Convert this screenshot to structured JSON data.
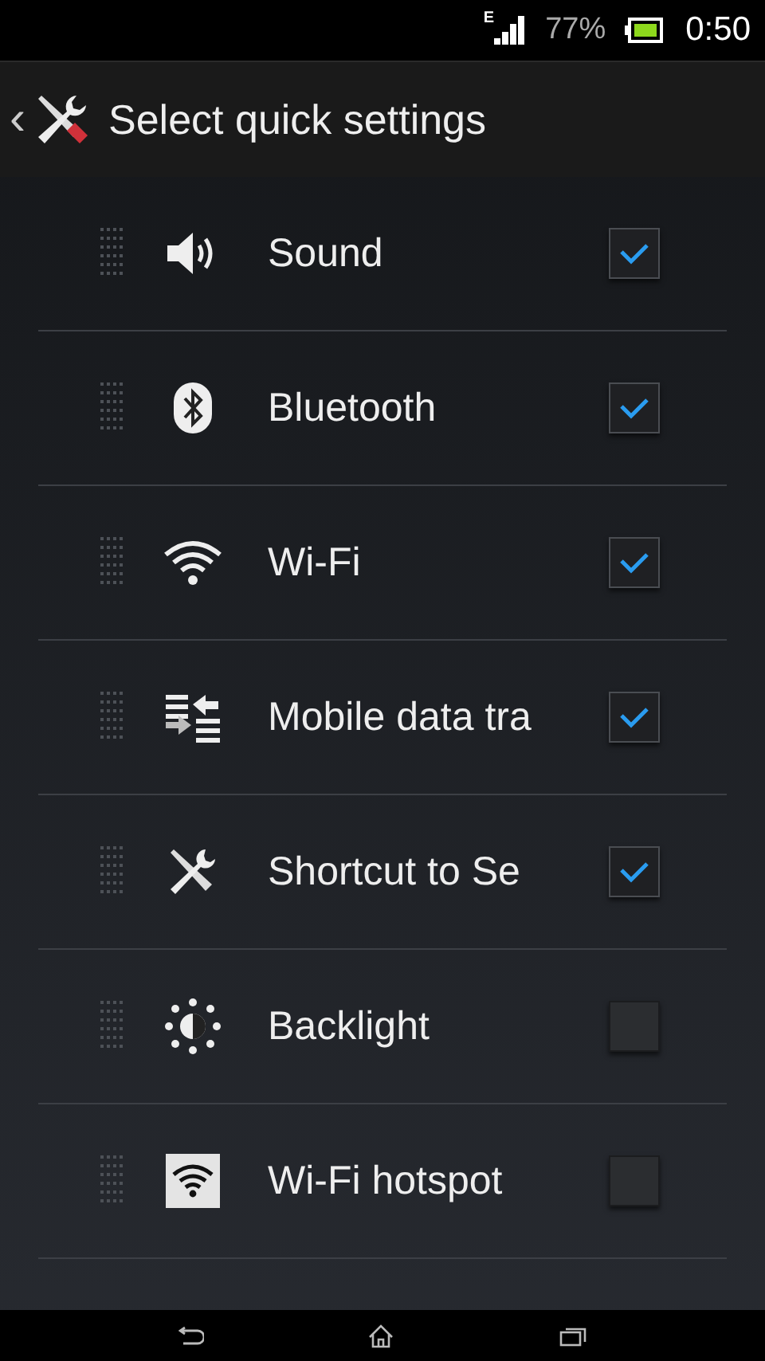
{
  "status_bar": {
    "network": "E",
    "battery": "77%",
    "time": "0:50"
  },
  "header": {
    "back": "‹",
    "title": "Select quick settings"
  },
  "items": [
    {
      "kind": "sound",
      "label": "Sound",
      "checked": true
    },
    {
      "kind": "bluetooth",
      "label": "Bluetooth",
      "checked": true
    },
    {
      "kind": "wifi",
      "label": "Wi-Fi",
      "checked": true
    },
    {
      "kind": "data",
      "label": "Mobile data tra",
      "checked": true
    },
    {
      "kind": "tools",
      "label": "Shortcut to Se",
      "checked": true
    },
    {
      "kind": "backlight",
      "label": "Backlight",
      "checked": false
    },
    {
      "kind": "hotspot",
      "label": "Wi-Fi hotspot",
      "checked": false
    }
  ]
}
